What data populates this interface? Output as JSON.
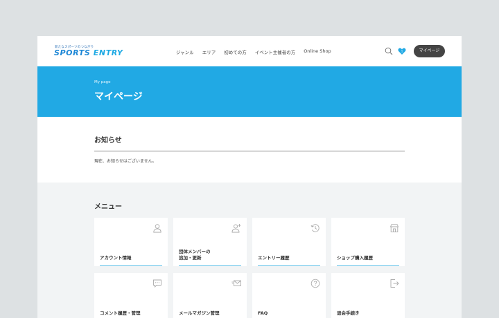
{
  "header": {
    "logo_tagline": "新たなスポーツのつながり",
    "logo_main_a": "SPORTS ",
    "logo_main_b": "ENTRY",
    "nav": [
      "ジャンル",
      "エリア",
      "初めての方",
      "イベント主催者の方",
      "Online Shop"
    ],
    "favorites_badge": "1",
    "mypage_label": "マイページ"
  },
  "hero": {
    "subtitle": "My page",
    "title": "マイページ"
  },
  "news": {
    "title": "お知らせ",
    "text": "現在、お知らせはございません。"
  },
  "menu": {
    "title": "メニュー",
    "items": [
      {
        "label": "アカウント情報",
        "icon": "user-icon"
      },
      {
        "label": "団体メンバーの\n追加・更新",
        "icon": "add-user-icon"
      },
      {
        "label": "エントリー履歴",
        "icon": "history-clock-icon"
      },
      {
        "label": "ショップ購入履歴",
        "icon": "shop-icon"
      },
      {
        "label": "コメント履歴・管理",
        "icon": "comment-icon"
      },
      {
        "label": "メールマガジン管理",
        "icon": "mail-icon"
      },
      {
        "label": "FAQ",
        "icon": "question-icon"
      },
      {
        "label": "退会手続き",
        "icon": "logout-icon"
      }
    ]
  },
  "colors": {
    "accent": "#21a9e4",
    "card_bar": "#5cbfe8",
    "button_dark": "#444444"
  }
}
